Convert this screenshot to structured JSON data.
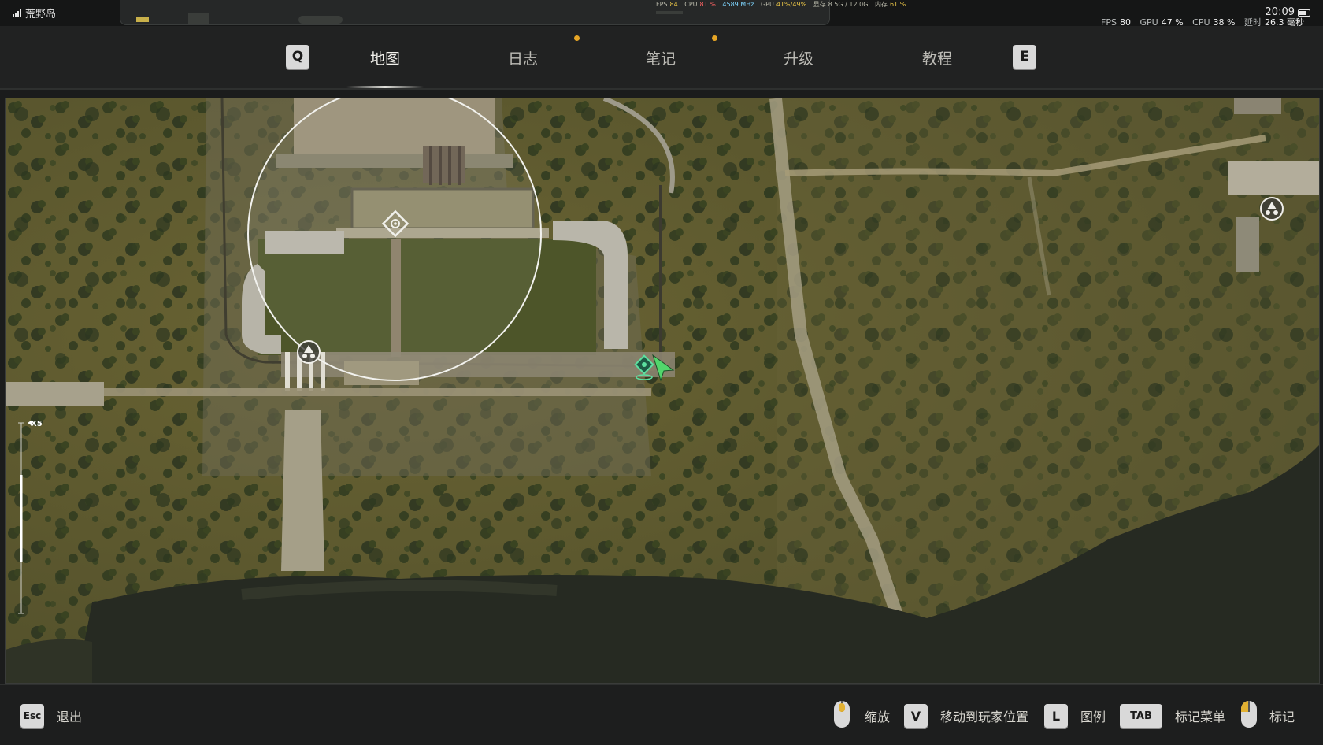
{
  "status_bar": {
    "carrier": "荒野岛",
    "clock": "20:09",
    "overlay_stats": [
      {
        "label": "FPS",
        "value": "84"
      },
      {
        "label": "CPU",
        "value": "81 %"
      },
      {
        "label": "",
        "value": "4589 MHz"
      },
      {
        "label": "GPU",
        "value": "41%/49%"
      },
      {
        "label": "显存",
        "value": "8.5G / 12.0G"
      },
      {
        "label": "内存",
        "value": "61 %"
      }
    ],
    "perf": {
      "fps_label": "FPS",
      "fps_value": "80",
      "gpu_label": "GPU",
      "gpu_value": "47 %",
      "cpu_label": "CPU",
      "cpu_value": "38 %",
      "latency_label": "延时",
      "latency_value": "26.3 毫秒"
    }
  },
  "nav": {
    "prev_key": "Q",
    "next_key": "E",
    "tabs": [
      {
        "label": "地图",
        "active": true,
        "notify": false
      },
      {
        "label": "日志",
        "active": false,
        "notify": true
      },
      {
        "label": "笔记",
        "active": false,
        "notify": true
      },
      {
        "label": "升级",
        "active": false,
        "notify": false
      },
      {
        "label": "教程",
        "active": false,
        "notify": false
      }
    ],
    "accent_color": "#e6a525"
  },
  "map": {
    "zoom_label": "X5",
    "zoom_level_fraction": 0.32,
    "markers": [
      {
        "type": "objective",
        "icon": "objective-diamond-icon"
      },
      {
        "type": "radiation",
        "icon": "radiation-icon"
      },
      {
        "type": "radiation",
        "icon": "radiation-icon"
      },
      {
        "type": "player",
        "icon": "player-arrow-icon",
        "color": "#52d66c"
      }
    ]
  },
  "controls": {
    "exit_key": "Esc",
    "exit_label": "退出",
    "zoom_label": "缩放",
    "move_key": "V",
    "move_label": "移动到玩家位置",
    "legend_key": "L",
    "legend_label": "图例",
    "mark_menu_key": "TAB",
    "mark_menu_label": "标记菜单",
    "mark_label": "标记"
  }
}
